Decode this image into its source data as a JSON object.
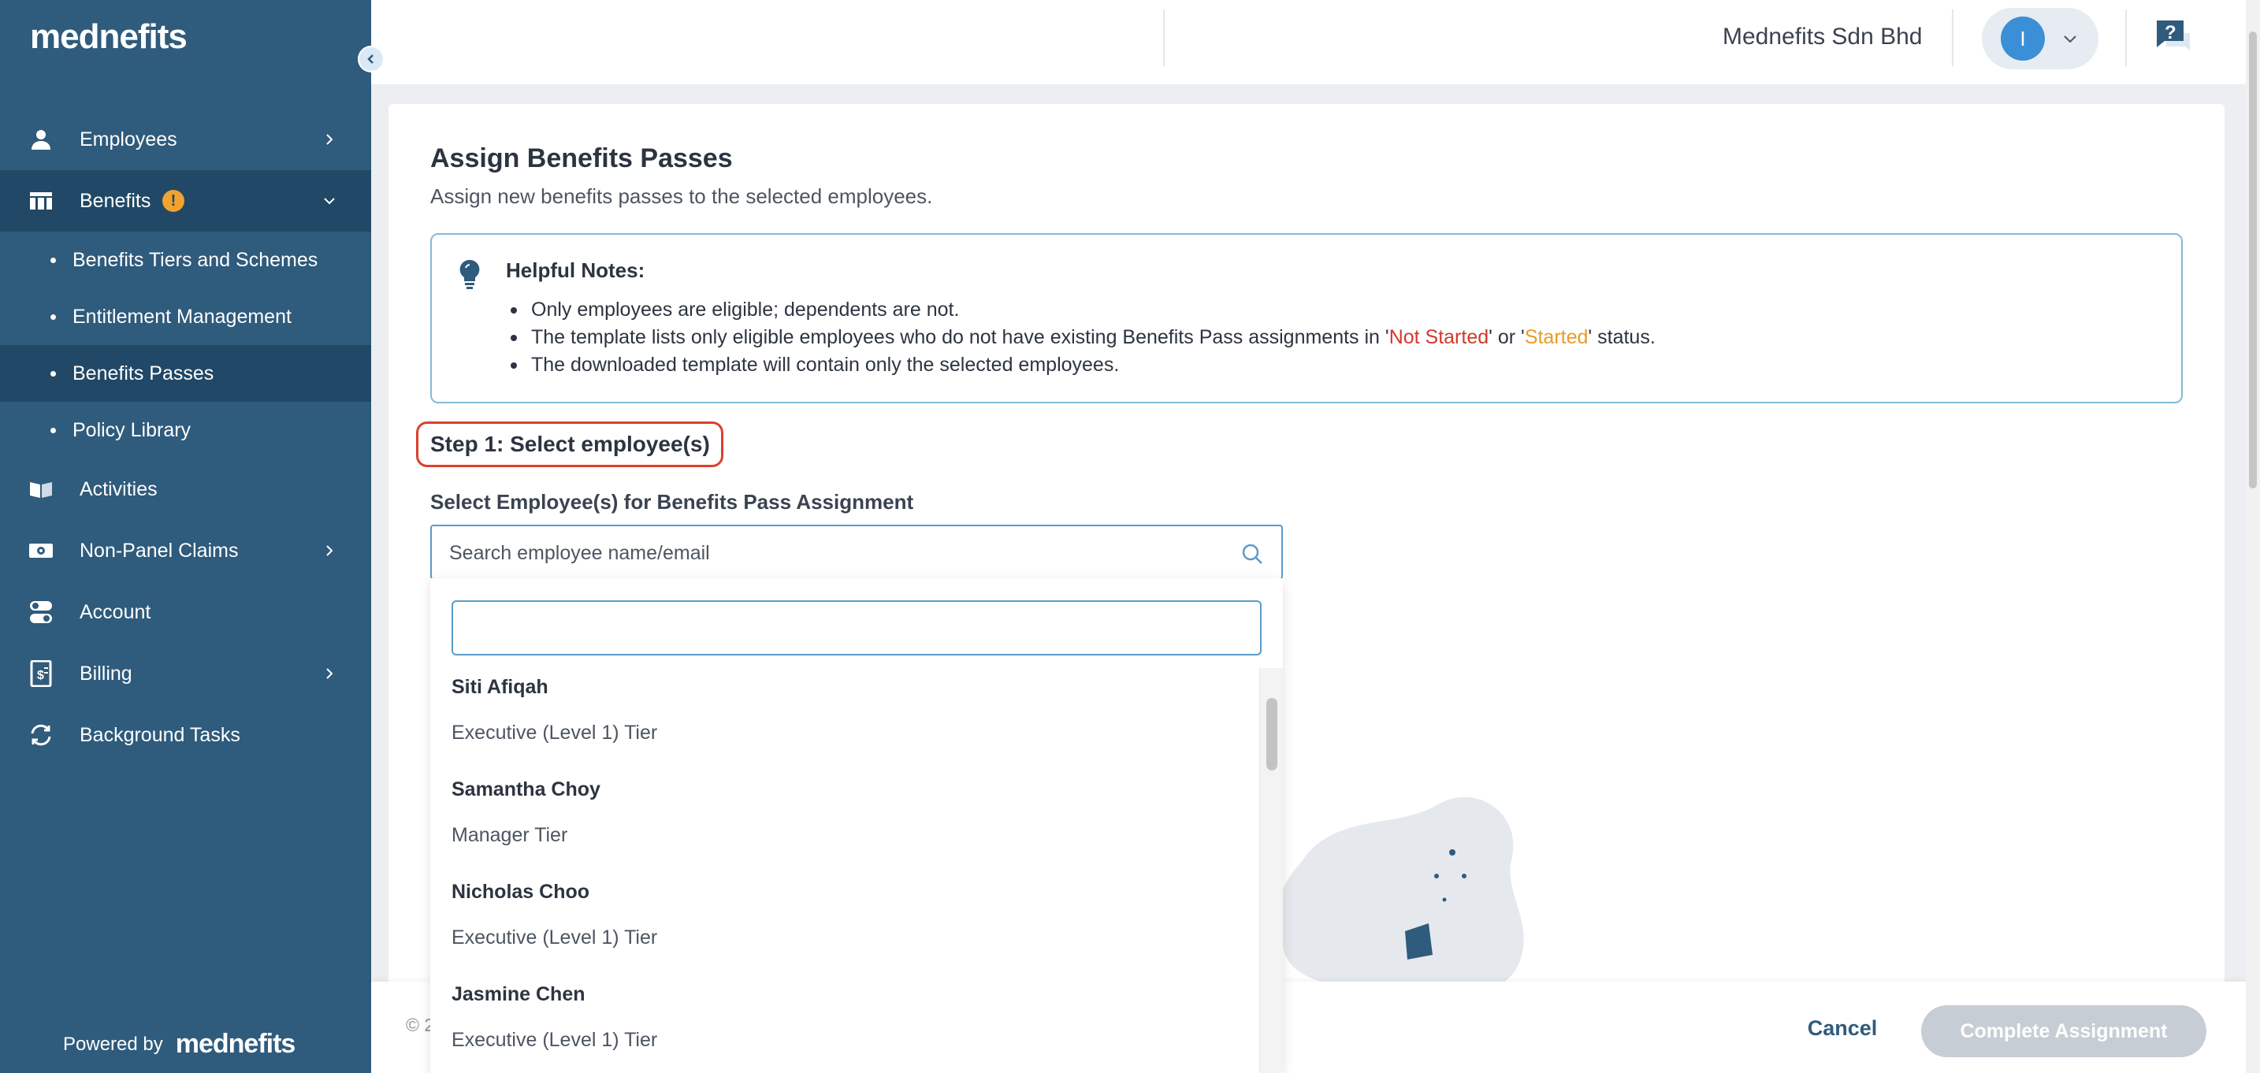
{
  "sidebar": {
    "logo": "mednefits",
    "nav": {
      "employees": "Employees",
      "benefits": "Benefits",
      "benefits_badge": "!",
      "activities": "Activities",
      "non_panel_claims": "Non-Panel Claims",
      "account": "Account",
      "billing": "Billing",
      "background_tasks": "Background Tasks"
    },
    "benefits_sub": {
      "tiers": "Benefits Tiers and Schemes",
      "entitlement": "Entitlement Management",
      "passes": "Benefits Passes",
      "policy": "Policy Library"
    },
    "powered_by": "Powered by",
    "powered_logo": "mednefits"
  },
  "topbar": {
    "company": "Mednefits Sdn Bhd",
    "avatar_initial": "I"
  },
  "page": {
    "title": "Assign Benefits Passes",
    "subtitle": "Assign new benefits passes to the selected employees.",
    "notes_title": "Helpful Notes:",
    "note1": "Only employees are eligible; dependents are not.",
    "note2_pre": "The template lists only eligible employees who do not have existing Benefits Pass assignments in '",
    "note2_not_started": "Not Started",
    "note2_mid": "' or '",
    "note2_started": "Started",
    "note2_post": "' status.",
    "note3": "The downloaded template will contain only the selected employees.",
    "step1": "Step 1: Select employee(s)",
    "select_label": "Select Employee(s) for Benefits Pass Assignment",
    "search_placeholder": "Search employee name/email",
    "dropdown_search_value": ""
  },
  "employees": [
    {
      "name": "Siti Afiqah",
      "tier": "Executive (Level 1) Tier"
    },
    {
      "name": "Samantha Choy",
      "tier": "Manager Tier"
    },
    {
      "name": "Nicholas Choo",
      "tier": "Executive (Level 1) Tier"
    },
    {
      "name": "Jasmine Chen",
      "tier": "Executive (Level 1) Tier"
    }
  ],
  "footer": {
    "copyright": "© 2",
    "cancel": "Cancel",
    "complete": "Complete Assignment"
  },
  "colors": {
    "sidebar": "#2f5b7c",
    "sidebar_active": "#214866",
    "accent": "#3b8fd6",
    "highlight_red": "#d0392b",
    "warning": "#f0a32f"
  }
}
